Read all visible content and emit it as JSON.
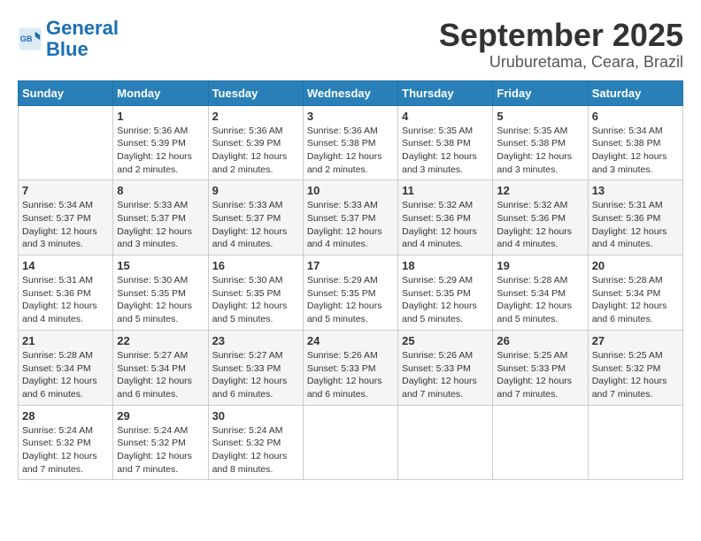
{
  "header": {
    "logo_line1": "General",
    "logo_line2": "Blue",
    "title": "September 2025",
    "subtitle": "Uruburetama, Ceara, Brazil"
  },
  "days_of_week": [
    "Sunday",
    "Monday",
    "Tuesday",
    "Wednesday",
    "Thursday",
    "Friday",
    "Saturday"
  ],
  "weeks": [
    [
      {
        "day": "",
        "info": ""
      },
      {
        "day": "1",
        "info": "Sunrise: 5:36 AM\nSunset: 5:39 PM\nDaylight: 12 hours\nand 2 minutes."
      },
      {
        "day": "2",
        "info": "Sunrise: 5:36 AM\nSunset: 5:39 PM\nDaylight: 12 hours\nand 2 minutes."
      },
      {
        "day": "3",
        "info": "Sunrise: 5:36 AM\nSunset: 5:38 PM\nDaylight: 12 hours\nand 2 minutes."
      },
      {
        "day": "4",
        "info": "Sunrise: 5:35 AM\nSunset: 5:38 PM\nDaylight: 12 hours\nand 3 minutes."
      },
      {
        "day": "5",
        "info": "Sunrise: 5:35 AM\nSunset: 5:38 PM\nDaylight: 12 hours\nand 3 minutes."
      },
      {
        "day": "6",
        "info": "Sunrise: 5:34 AM\nSunset: 5:38 PM\nDaylight: 12 hours\nand 3 minutes."
      }
    ],
    [
      {
        "day": "7",
        "info": "Sunrise: 5:34 AM\nSunset: 5:37 PM\nDaylight: 12 hours\nand 3 minutes."
      },
      {
        "day": "8",
        "info": "Sunrise: 5:33 AM\nSunset: 5:37 PM\nDaylight: 12 hours\nand 3 minutes."
      },
      {
        "day": "9",
        "info": "Sunrise: 5:33 AM\nSunset: 5:37 PM\nDaylight: 12 hours\nand 4 minutes."
      },
      {
        "day": "10",
        "info": "Sunrise: 5:33 AM\nSunset: 5:37 PM\nDaylight: 12 hours\nand 4 minutes."
      },
      {
        "day": "11",
        "info": "Sunrise: 5:32 AM\nSunset: 5:36 PM\nDaylight: 12 hours\nand 4 minutes."
      },
      {
        "day": "12",
        "info": "Sunrise: 5:32 AM\nSunset: 5:36 PM\nDaylight: 12 hours\nand 4 minutes."
      },
      {
        "day": "13",
        "info": "Sunrise: 5:31 AM\nSunset: 5:36 PM\nDaylight: 12 hours\nand 4 minutes."
      }
    ],
    [
      {
        "day": "14",
        "info": "Sunrise: 5:31 AM\nSunset: 5:36 PM\nDaylight: 12 hours\nand 4 minutes."
      },
      {
        "day": "15",
        "info": "Sunrise: 5:30 AM\nSunset: 5:35 PM\nDaylight: 12 hours\nand 5 minutes."
      },
      {
        "day": "16",
        "info": "Sunrise: 5:30 AM\nSunset: 5:35 PM\nDaylight: 12 hours\nand 5 minutes."
      },
      {
        "day": "17",
        "info": "Sunrise: 5:29 AM\nSunset: 5:35 PM\nDaylight: 12 hours\nand 5 minutes."
      },
      {
        "day": "18",
        "info": "Sunrise: 5:29 AM\nSunset: 5:35 PM\nDaylight: 12 hours\nand 5 minutes."
      },
      {
        "day": "19",
        "info": "Sunrise: 5:28 AM\nSunset: 5:34 PM\nDaylight: 12 hours\nand 5 minutes."
      },
      {
        "day": "20",
        "info": "Sunrise: 5:28 AM\nSunset: 5:34 PM\nDaylight: 12 hours\nand 6 minutes."
      }
    ],
    [
      {
        "day": "21",
        "info": "Sunrise: 5:28 AM\nSunset: 5:34 PM\nDaylight: 12 hours\nand 6 minutes."
      },
      {
        "day": "22",
        "info": "Sunrise: 5:27 AM\nSunset: 5:34 PM\nDaylight: 12 hours\nand 6 minutes."
      },
      {
        "day": "23",
        "info": "Sunrise: 5:27 AM\nSunset: 5:33 PM\nDaylight: 12 hours\nand 6 minutes."
      },
      {
        "day": "24",
        "info": "Sunrise: 5:26 AM\nSunset: 5:33 PM\nDaylight: 12 hours\nand 6 minutes."
      },
      {
        "day": "25",
        "info": "Sunrise: 5:26 AM\nSunset: 5:33 PM\nDaylight: 12 hours\nand 7 minutes."
      },
      {
        "day": "26",
        "info": "Sunrise: 5:25 AM\nSunset: 5:33 PM\nDaylight: 12 hours\nand 7 minutes."
      },
      {
        "day": "27",
        "info": "Sunrise: 5:25 AM\nSunset: 5:32 PM\nDaylight: 12 hours\nand 7 minutes."
      }
    ],
    [
      {
        "day": "28",
        "info": "Sunrise: 5:24 AM\nSunset: 5:32 PM\nDaylight: 12 hours\nand 7 minutes."
      },
      {
        "day": "29",
        "info": "Sunrise: 5:24 AM\nSunset: 5:32 PM\nDaylight: 12 hours\nand 7 minutes."
      },
      {
        "day": "30",
        "info": "Sunrise: 5:24 AM\nSunset: 5:32 PM\nDaylight: 12 hours\nand 8 minutes."
      },
      {
        "day": "",
        "info": ""
      },
      {
        "day": "",
        "info": ""
      },
      {
        "day": "",
        "info": ""
      },
      {
        "day": "",
        "info": ""
      }
    ]
  ]
}
